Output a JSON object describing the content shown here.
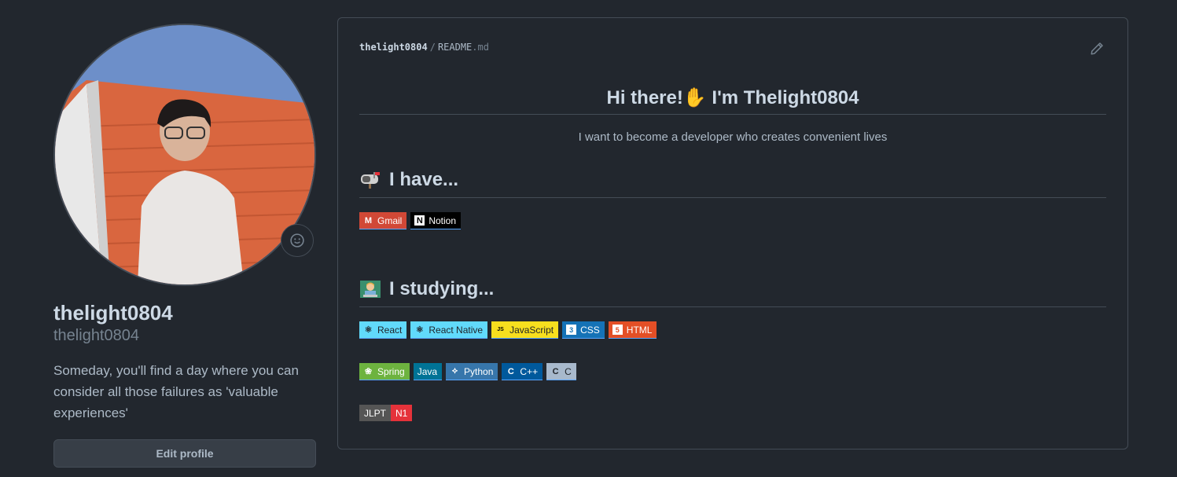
{
  "profile": {
    "fullname": "thelight0804",
    "username": "thelight0804",
    "bio": "Someday, you'll find a day where you can consider all those failures as 'valuable experiences'",
    "edit_label": "Edit profile"
  },
  "readme": {
    "user": "thelight0804",
    "sep": "/",
    "file": "README",
    "ext": ".md",
    "heading": "Hi there!✋ I'm Thelight0804",
    "tagline": "I want to become a developer who creates convenient lives",
    "have_title": "I have...",
    "studying_title": "I studying...",
    "have_badges": [
      {
        "label": "Gmail",
        "color": "#d14836",
        "icon": "gmail-icon"
      },
      {
        "label": "Notion",
        "color": "#000000",
        "icon": "notion-icon"
      }
    ],
    "study_row1": [
      {
        "label": "React",
        "color": "#61dafb",
        "text": "#1f2328",
        "icon": "react-icon"
      },
      {
        "label": "React Native",
        "color": "#61dafb",
        "text": "#1f2328",
        "icon": "react-icon"
      },
      {
        "label": "JavaScript",
        "color": "#f7df1e",
        "text": "#1f2328",
        "icon": "javascript-icon"
      },
      {
        "label": "CSS",
        "color": "#1572b6",
        "text": "#ffffff",
        "icon": "css3-icon"
      },
      {
        "label": "HTML",
        "color": "#e34f26",
        "text": "#ffffff",
        "icon": "html5-icon"
      }
    ],
    "study_row2": [
      {
        "label": "Spring",
        "color": "#6db33f",
        "text": "#ffffff",
        "icon": "spring-icon"
      },
      {
        "label": "Java",
        "color": "#007396",
        "text": "#ffffff",
        "icon": ""
      },
      {
        "label": "Python",
        "color": "#3776ab",
        "text": "#ffffff",
        "icon": "python-icon"
      },
      {
        "label": "C++",
        "color": "#00599c",
        "text": "#ffffff",
        "icon": "cplusplus-icon"
      },
      {
        "label": "C",
        "color": "#a8b9cc",
        "text": "#1f2328",
        "icon": "c-icon"
      }
    ],
    "jlpt": {
      "left": "JLPT",
      "right": "N1",
      "left_color": "#555555",
      "right_color": "#e5323a"
    }
  }
}
